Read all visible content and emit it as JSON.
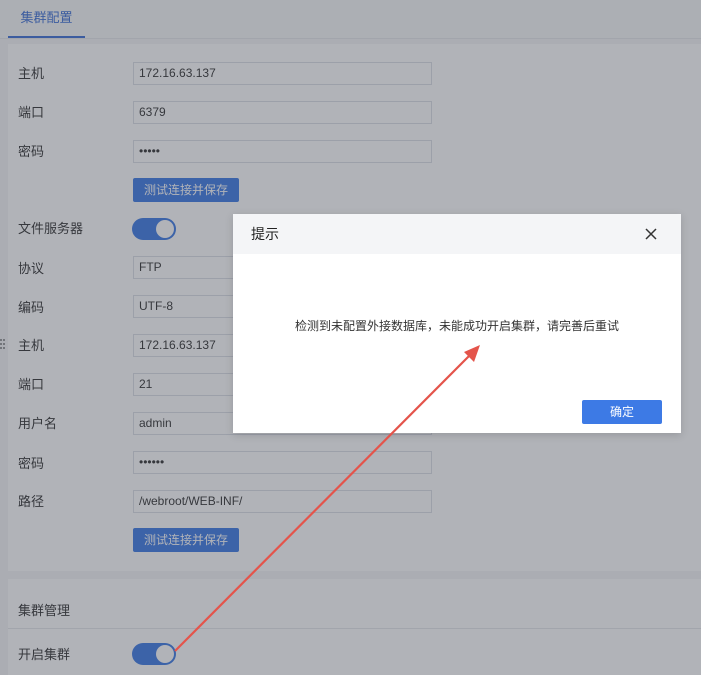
{
  "tab": {
    "label": "集群配置"
  },
  "db": {
    "host_label": "主机",
    "host_value": "172.16.63.137",
    "port_label": "端口",
    "port_value": "6379",
    "password_label": "密码",
    "password_value": "•••••",
    "test_save_label": "测试连接并保存"
  },
  "file_server": {
    "label": "文件服务器",
    "enabled": true,
    "protocol_label": "协议",
    "protocol_value": "FTP",
    "encoding_label": "编码",
    "encoding_value": "UTF-8",
    "host_label": "主机",
    "host_value": "172.16.63.137",
    "port_label": "端口",
    "port_value": "21",
    "username_label": "用户名",
    "username_value": "admin",
    "password_label": "密码",
    "password_value": "••••••",
    "path_label": "路径",
    "path_value": "/webroot/WEB-INF/",
    "test_save_label": "测试连接并保存"
  },
  "cluster": {
    "section_title": "集群管理",
    "enable_label": "开启集群",
    "enabled": true
  },
  "dialog": {
    "title": "提示",
    "message": "检测到未配置外接数据库，未能成功开启集群，请完善后重试",
    "ok_label": "确定"
  },
  "colors": {
    "primary": "#3d7ae5",
    "annotation_arrow": "#e4544b"
  },
  "icons": {
    "close": "close-icon",
    "drag_handle": "drag-handle-icon"
  }
}
